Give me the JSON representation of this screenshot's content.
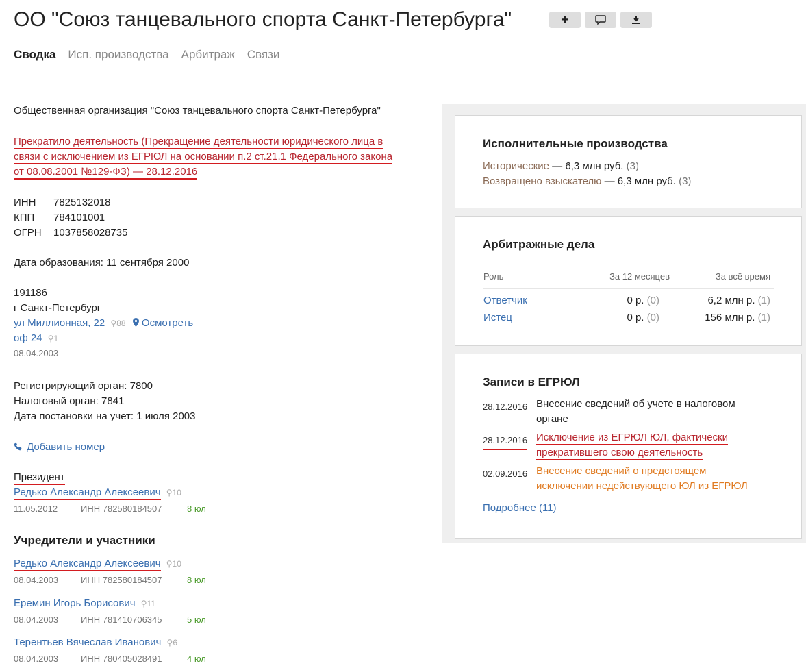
{
  "header": {
    "title": "ОО \"Союз танцевального спорта Санкт-Петербурга\"",
    "tabs": [
      "Сводка",
      "Исп. производства",
      "Арбитраж",
      "Связи"
    ]
  },
  "left": {
    "full_name": "Общественная организация \"Союз танцевального спорта Санкт-Петербурга\"",
    "status_lines": [
      "Прекратило деятельность (Прекращение деятельности юридического лица в",
      "связи с исключением из ЕГРЮЛ на основании п.2 ст.21.1 Федерального закона",
      "от 08.08.2001 №129-ФЗ) — 28.12.2016"
    ],
    "ids": [
      {
        "label": "ИНН",
        "value": "7825132018"
      },
      {
        "label": "КПП",
        "value": "784101001"
      },
      {
        "label": "ОГРН",
        "value": "1037858028735"
      }
    ],
    "founded": "Дата образования: 11 сентября 2000",
    "address": {
      "zip": "191186",
      "city": "г Санкт-Петербург",
      "street": "ул Миллионная, 22",
      "street_count": "88",
      "view_link": "Осмотреть",
      "office": "оф 24",
      "office_count": "1",
      "date": "08.04.2003"
    },
    "registration": [
      "Регистрирующий орган: 7800",
      "Налоговый орган: 7841",
      "Дата постановки на учет: 1 июля 2003"
    ],
    "add_phone": "Добавить номер",
    "president": {
      "role": "Президент",
      "name": "Редько Александр Алексеевич",
      "count": "10",
      "date": "11.05.2012",
      "inn": "ИНН 782580184507",
      "orgs": "8 юл"
    },
    "founders_title": "Учредители и участники",
    "founders": [
      {
        "name": "Редько Александр Алексеевич",
        "count": "10",
        "date": "08.04.2003",
        "inn": "ИНН 782580184507",
        "orgs": "8 юл"
      },
      {
        "name": "Еремин Игорь Борисович",
        "count": "11",
        "date": "08.04.2003",
        "inn": "ИНН 781410706345",
        "orgs": "5 юл"
      },
      {
        "name": "Терентьев Вячеслав Иванович",
        "count": "6",
        "date": "08.04.2003",
        "inn": "ИНН 780405028491",
        "orgs": "4 юл"
      }
    ]
  },
  "enforcement": {
    "title": "Исполнительные производства",
    "historical_label": "Исторические",
    "historical_value": "— 6,3 млн руб.",
    "historical_count": "(3)",
    "returned_label": "Возвращено взыскателю",
    "returned_value": "— 6,3 млн руб.",
    "returned_count": "(3)"
  },
  "arbitration": {
    "title": "Арбитражные дела",
    "headers": [
      "Роль",
      "За 12 месяцев",
      "За всё время"
    ],
    "rows": [
      {
        "role": "Ответчик",
        "m12": "0 р.",
        "m12c": "(0)",
        "all": "6,2 млн р.",
        "allc": "(1)"
      },
      {
        "role": "Истец",
        "m12": "0 р.",
        "m12c": "(0)",
        "all": "156 млн р.",
        "allc": "(1)"
      }
    ]
  },
  "egrul": {
    "title": "Записи в ЕГРЮЛ",
    "entries": [
      {
        "date": "28.12.2016",
        "lines": [
          "Внесение сведений об учете в налоговом",
          "органе"
        ]
      },
      {
        "date": "28.12.2016",
        "lines": [
          "Исключение из ЕГРЮЛ ЮЛ, фактически",
          "прекратившего свою деятельность"
        ]
      },
      {
        "date": "02.09.2016",
        "lines": [
          "Внесение сведений о предстоящем",
          "исключении недействующего ЮЛ из ЕГРЮЛ"
        ]
      }
    ],
    "more": "Подробнее (11)"
  },
  "colors": {
    "link": "#3a6fb0",
    "status_red": "#b8262f",
    "orange": "#e07b22",
    "green": "#4a9a2a",
    "underline": "#d31c20"
  }
}
